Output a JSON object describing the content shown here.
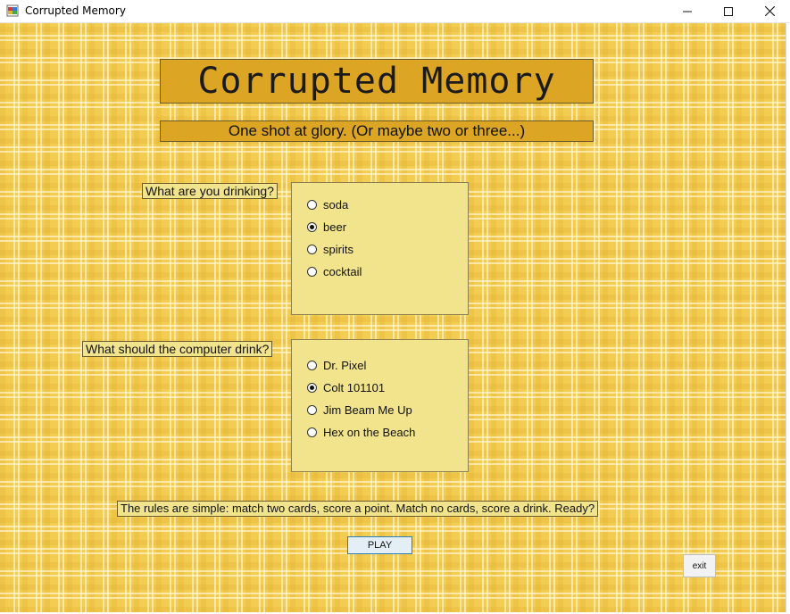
{
  "window": {
    "title": "Corrupted Memory",
    "icon": "app-icon",
    "controls": {
      "minimize": "minimize-icon",
      "maximize": "maximize-icon",
      "close": "close-icon"
    }
  },
  "header": {
    "title": "Corrupted Memory",
    "subtitle": "One shot at glory. (Or maybe two or three...)"
  },
  "player_drink": {
    "label": "What are you drinking?",
    "options": [
      "soda",
      "beer",
      "spirits",
      "cocktail"
    ],
    "selected": "beer"
  },
  "computer_drink": {
    "label": "What should the computer drink?",
    "options": [
      "Dr. Pixel",
      "Colt 101101",
      "Jim Beam Me Up",
      "Hex on the Beach"
    ],
    "selected": "Colt 101101"
  },
  "rules": "The rules are simple: match two cards, score a point. Match no cards, score a drink. Ready?",
  "buttons": {
    "play": "PLAY",
    "exit": "exit"
  },
  "colors": {
    "background": "#f3cc52",
    "header_fill": "#dca524",
    "panel_fill": "#f1e48c",
    "play_border": "#2b7fb8"
  }
}
